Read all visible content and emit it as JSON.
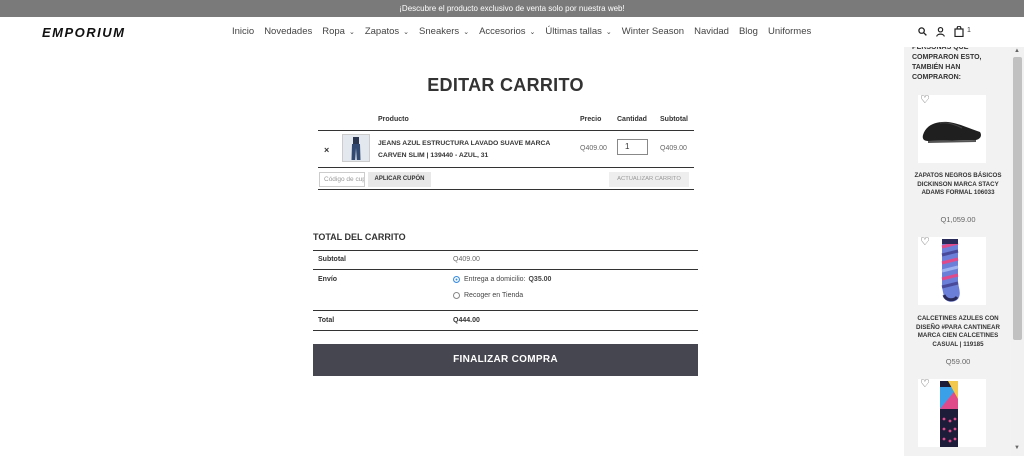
{
  "announcement": "¡Descubre el producto exclusivo de venta solo por nuestra web!",
  "logo": "EMPORIUM",
  "nav": [
    {
      "label": "Inicio",
      "chevron": false
    },
    {
      "label": "Novedades",
      "chevron": false
    },
    {
      "label": "Ropa",
      "chevron": true
    },
    {
      "label": "Zapatos",
      "chevron": true
    },
    {
      "label": "Sneakers",
      "chevron": true
    },
    {
      "label": "Accesorios",
      "chevron": true
    },
    {
      "label": "Últimas tallas",
      "chevron": true
    },
    {
      "label": "Winter Season",
      "chevron": false
    },
    {
      "label": "Navidad",
      "chevron": false
    },
    {
      "label": "Blog",
      "chevron": false
    },
    {
      "label": "Uniformes",
      "chevron": false
    }
  ],
  "header_icons": {
    "search": "search-icon",
    "account": "user-icon",
    "cart": "bag-icon",
    "cart_count": "1"
  },
  "page_title": "EDITAR CARRITO",
  "cart_table": {
    "headers": {
      "product": "Producto",
      "price": "Precio",
      "quantity": "Cantidad",
      "subtotal": "Subtotal"
    },
    "items": [
      {
        "name": "JEANS AZUL ESTRUCTURA LAVADO SUAVE MARCA CARVEN SLIM | 139440 - AZUL, 31",
        "price": "Q409.00",
        "quantity": "1",
        "subtotal": "Q409.00"
      }
    ],
    "remove_symbol": "×",
    "coupon_placeholder": "Código de cupón",
    "apply_coupon": "APLICAR CUPÓN",
    "update_cart": "ACTUALIZAR CARRITO"
  },
  "totals": {
    "heading": "TOTAL DEL CARRITO",
    "subtotal_label": "Subtotal",
    "subtotal_value": "Q409.00",
    "shipping_label": "Envío",
    "shipping_options": [
      {
        "label": "Entrega a domicilio:",
        "price": "Q35.00",
        "selected": true
      },
      {
        "label": "Recoger en Tienda",
        "price": "",
        "selected": false
      }
    ],
    "total_label": "Total",
    "total_value": "Q444.00"
  },
  "checkout_button": "FINALIZAR COMPRA",
  "sidebar": {
    "title": "PERSONAS QUE COMPRARON ESTO, TAMBIÉN HAN COMPRARON:",
    "products": [
      {
        "name": "ZAPATOS NEGROS BÁSICOS DICKINSON MARCA STACY ADAMS FORMAL 106033",
        "price": "Q1,059.00",
        "image": "black-shoe"
      },
      {
        "name": "CALCETINES AZULES CON DISEÑO #PARA CANTINEAR MARCA CIEN CALCETINES CASUAL | 119185",
        "price": "Q59.00",
        "image": "striped-socks"
      },
      {
        "name": "",
        "price": "",
        "image": "pattern-socks"
      }
    ]
  },
  "colors": {
    "topbar": "#7a7a7a",
    "checkout": "#464650",
    "radio_selected": "#3b8ee0"
  }
}
